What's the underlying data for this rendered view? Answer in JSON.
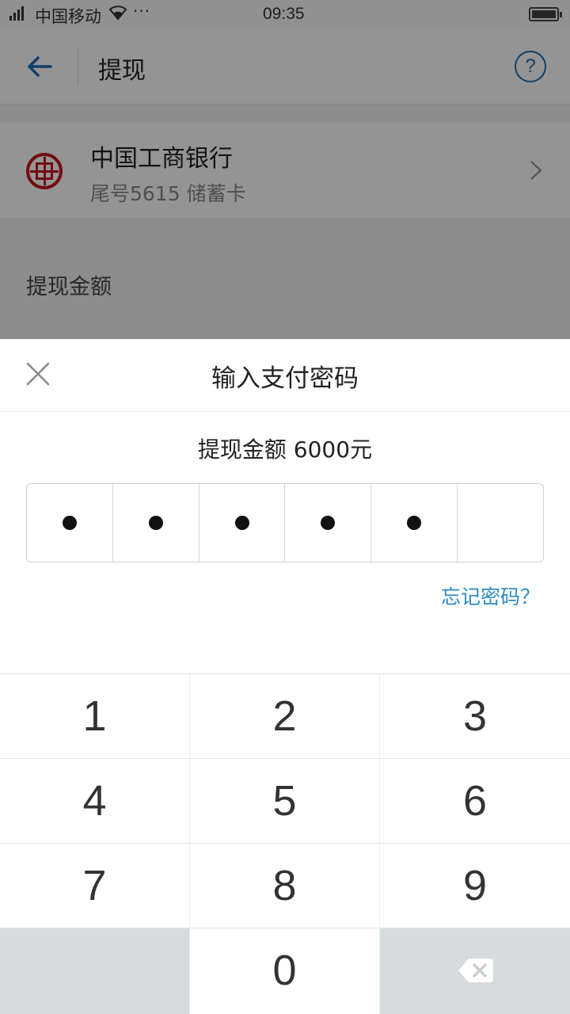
{
  "status_bar": {
    "carrier": "中国移动",
    "more": "···",
    "time": "09:35"
  },
  "header": {
    "title": "提现",
    "help_symbol": "?"
  },
  "bank_card": {
    "bank_name": "中国工商银行",
    "card_info": "尾号5615 储蓄卡"
  },
  "amount_section": {
    "label": "提现金额"
  },
  "password_sheet": {
    "title": "输入支付密码",
    "amount_text": "提现金额 6000元",
    "pin_length": 6,
    "pin_filled": 5,
    "forgot_link": "忘记密码？"
  },
  "keypad": {
    "rows": [
      [
        "1",
        "2",
        "3"
      ],
      [
        "4",
        "5",
        "6"
      ],
      [
        "7",
        "8",
        "9"
      ],
      [
        "",
        "0",
        "delete"
      ]
    ]
  },
  "colors": {
    "accent_blue": "#1a6fb5",
    "link_blue": "#2e8bc0",
    "icbc_red": "#c4161c",
    "overlay": "rgba(0,0,0,0.42)"
  }
}
